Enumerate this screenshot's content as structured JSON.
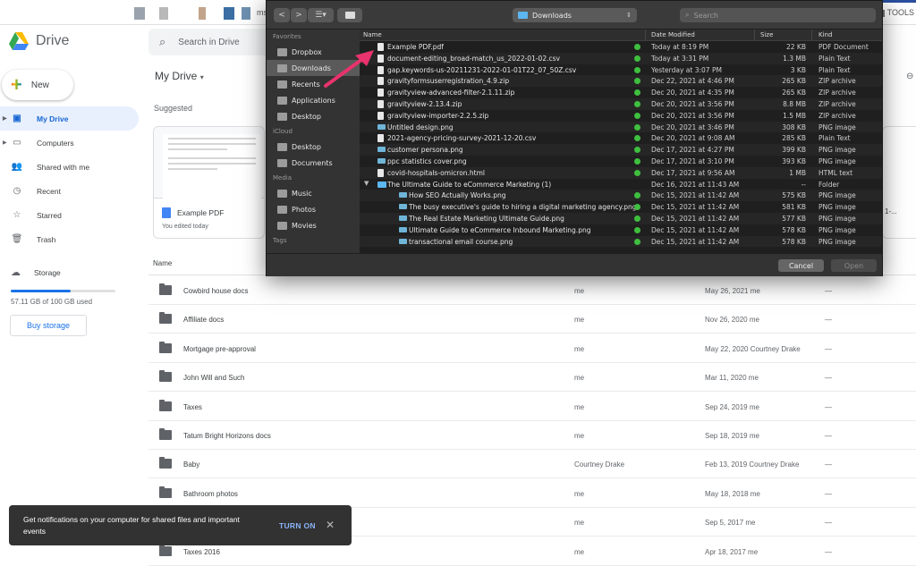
{
  "top": {
    "tools_label": "TOOLS",
    "ext_fragment": "ms"
  },
  "app": {
    "name": "Drive"
  },
  "sidebar": {
    "new_label": "New",
    "items": [
      {
        "label": "My Drive",
        "icon": "my-drive-icon"
      },
      {
        "label": "Computers",
        "icon": "computer-icon"
      },
      {
        "label": "Shared with me",
        "icon": "people-icon"
      },
      {
        "label": "Recent",
        "icon": "clock-icon"
      },
      {
        "label": "Starred",
        "icon": "star-icon"
      },
      {
        "label": "Trash",
        "icon": "trash-icon"
      }
    ],
    "storage_label": "Storage",
    "storage_used": "57.11 GB of 100 GB used",
    "storage_fraction": 0.5711,
    "buy_storage": "Buy storage"
  },
  "search": {
    "placeholder": "Search in Drive"
  },
  "main": {
    "title": "My Drive",
    "suggested_label": "Suggested",
    "card": {
      "title": "Example PDF",
      "subtitle": "You edited today"
    },
    "card2_fragment": "1-...",
    "name_header": "Name",
    "files": [
      {
        "name": "Cowbird house docs",
        "owner": "me",
        "modified": "May 26, 2021",
        "modified_by": "me",
        "size": "—"
      },
      {
        "name": "Affiliate docs",
        "owner": "me",
        "modified": "Nov 26, 2020",
        "modified_by": "me",
        "size": "—"
      },
      {
        "name": "Mortgage pre-approval",
        "owner": "me",
        "modified": "May 22, 2020",
        "modified_by": "Courtney Drake",
        "size": "—"
      },
      {
        "name": "John Will and Such",
        "owner": "me",
        "modified": "Mar 11, 2020",
        "modified_by": "me",
        "size": "—"
      },
      {
        "name": "Taxes",
        "owner": "me",
        "modified": "Sep 24, 2019",
        "modified_by": "me",
        "size": "—"
      },
      {
        "name": "Tatum Bright Horizons docs",
        "owner": "me",
        "modified": "Sep 18, 2019",
        "modified_by": "me",
        "size": "—"
      },
      {
        "name": "Baby",
        "owner": "Courtney Drake",
        "modified": "Feb 13, 2019",
        "modified_by": "Courtney Drake",
        "size": "—"
      },
      {
        "name": "Bathroom photos",
        "owner": "me",
        "modified": "May 18, 2018",
        "modified_by": "me",
        "size": "—"
      },
      {
        "name": "",
        "owner": "me",
        "modified": "Sep 5, 2017",
        "modified_by": "me",
        "size": "—"
      },
      {
        "name": "Taxes 2016",
        "owner": "me",
        "modified": "Apr 18, 2017",
        "modified_by": "me",
        "size": "—"
      }
    ]
  },
  "snackbar": {
    "message": "Get notifications on your computer for shared files and important events",
    "action": "TURN ON",
    "close": "✕"
  },
  "dialog": {
    "location": "Downloads",
    "search_placeholder": "Search",
    "sidebar": {
      "favorites_label": "Favorites",
      "favorites": [
        "Dropbox",
        "Downloads",
        "Recents",
        "Applications",
        "Desktop"
      ],
      "icloud_label": "iCloud",
      "icloud": [
        "Desktop",
        "Documents"
      ],
      "media_label": "Media",
      "media": [
        "Music",
        "Photos",
        "Movies"
      ],
      "tags_label": "Tags"
    },
    "columns": {
      "name": "Name",
      "date": "Date Modified",
      "size": "Size",
      "kind": "Kind"
    },
    "rows": [
      {
        "name": "Example PDF.pdf",
        "date": "Today at 8:19 PM",
        "size": "22 KB",
        "kind": "PDF Document",
        "type": "doc"
      },
      {
        "name": "document-editing_broad-match_us_2022-01-02.csv",
        "date": "Today at 3:31 PM",
        "size": "1.3 MB",
        "kind": "Plain Text",
        "type": "doc"
      },
      {
        "name": "gap.keywords-us-20211231-2022-01-01T22_07_50Z.csv",
        "date": "Yesterday at 3:07 PM",
        "size": "3 KB",
        "kind": "Plain Text",
        "type": "doc"
      },
      {
        "name": "gravityformsuserregistration_4.9.zip",
        "date": "Dec 22, 2021 at 4:46 PM",
        "size": "265 KB",
        "kind": "ZIP archive",
        "type": "doc"
      },
      {
        "name": "gravityview-advanced-filter-2.1.11.zip",
        "date": "Dec 20, 2021 at 4:35 PM",
        "size": "265 KB",
        "kind": "ZIP archive",
        "type": "doc"
      },
      {
        "name": "gravityview-2.13.4.zip",
        "date": "Dec 20, 2021 at 3:56 PM",
        "size": "8.8 MB",
        "kind": "ZIP archive",
        "type": "doc"
      },
      {
        "name": "gravityview-importer-2.2.5.zip",
        "date": "Dec 20, 2021 at 3:56 PM",
        "size": "1.5 MB",
        "kind": "ZIP archive",
        "type": "doc"
      },
      {
        "name": "Untitled design.png",
        "date": "Dec 20, 2021 at 3:46 PM",
        "size": "308 KB",
        "kind": "PNG image",
        "type": "img"
      },
      {
        "name": "2021-agency-pricing-survey-2021-12-20.csv",
        "date": "Dec 20, 2021 at 9:08 AM",
        "size": "285 KB",
        "kind": "Plain Text",
        "type": "doc"
      },
      {
        "name": "customer persona.png",
        "date": "Dec 17, 2021 at 4:27 PM",
        "size": "399 KB",
        "kind": "PNG image",
        "type": "img"
      },
      {
        "name": "ppc statistics cover.png",
        "date": "Dec 17, 2021 at 3:10 PM",
        "size": "393 KB",
        "kind": "PNG image",
        "type": "img"
      },
      {
        "name": "covid-hospitals-omicron.html",
        "date": "Dec 17, 2021 at 9:56 AM",
        "size": "1 MB",
        "kind": "HTML text",
        "type": "doc"
      },
      {
        "name": "The Ultimate Guide to eCommerce Marketing (1)",
        "date": "Dec 16, 2021 at 11:43 AM",
        "size": "--",
        "kind": "Folder",
        "type": "folder"
      },
      {
        "name": "How SEO Actually Works.png",
        "date": "Dec 15, 2021 at 11:42 AM",
        "size": "575 KB",
        "kind": "PNG image",
        "type": "img",
        "indent": true
      },
      {
        "name": "The busy executive's guide to hiring a digital marketing agency.png",
        "date": "Dec 15, 2021 at 11:42 AM",
        "size": "581 KB",
        "kind": "PNG image",
        "type": "img",
        "indent": true
      },
      {
        "name": "The Real Estate Marketing Ultimate Guide.png",
        "date": "Dec 15, 2021 at 11:42 AM",
        "size": "577 KB",
        "kind": "PNG image",
        "type": "img",
        "indent": true
      },
      {
        "name": "Ultimate Guide to eCommerce Inbound Marketing.png",
        "date": "Dec 15, 2021 at 11:42 AM",
        "size": "578 KB",
        "kind": "PNG image",
        "type": "img",
        "indent": true
      },
      {
        "name": "transactional email course.png",
        "date": "Dec 15, 2021 at 11:42 AM",
        "size": "578 KB",
        "kind": "PNG image",
        "type": "img",
        "indent": true
      }
    ],
    "cancel": "Cancel",
    "open": "Open",
    "accent_color": "#e8336d"
  }
}
